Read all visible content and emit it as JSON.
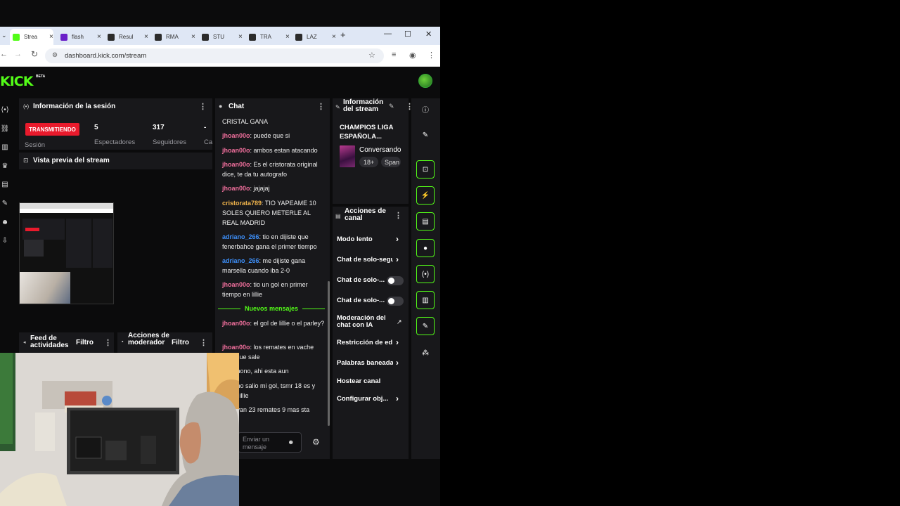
{
  "browser": {
    "tabs": [
      {
        "title": "Strea",
        "active": true,
        "favicon_color": "#53fc18"
      },
      {
        "title": "flash",
        "active": false,
        "favicon_color": "#6a1fc8"
      },
      {
        "title": "Resul",
        "active": false,
        "favicon_color": "#2b2b2b"
      },
      {
        "title": "RMA",
        "active": false,
        "favicon_color": "#2b2b2b"
      },
      {
        "title": "STU",
        "active": false,
        "favicon_color": "#2b2b2b"
      },
      {
        "title": "TRA",
        "active": false,
        "favicon_color": "#2b2b2b"
      },
      {
        "title": "LAZ",
        "active": false,
        "favicon_color": "#2b2b2b"
      }
    ],
    "new_tab": "+",
    "url": "dashboard.kick.com/stream"
  },
  "brand": {
    "logo": "KICK",
    "beta": "BETA",
    "accent": "#53fc18"
  },
  "session": {
    "title": "Información de la sesión",
    "status": "TRANSMITIENDO",
    "session_label": "Sesión",
    "viewers_value": "5",
    "viewers_label": "Espectadores",
    "followers_value": "317",
    "followers_label": "Seguidores",
    "extra_value": "-",
    "extra_label": "Ca"
  },
  "preview": {
    "title": "Vista previa del stream"
  },
  "activity": {
    "title": "Feed de actividades",
    "filter": "Filtro"
  },
  "mod_actions": {
    "title": "Acciones de moderador",
    "filter": "Filtro"
  },
  "chat": {
    "title": "Chat",
    "messages": [
      {
        "user": "",
        "text": "CRISTAL GANA",
        "color": "pink"
      },
      {
        "user": "jhoan00o",
        "text": "puede que si",
        "color": "pink"
      },
      {
        "user": "jhoan00o",
        "text": "ambos estan atacando",
        "color": "pink"
      },
      {
        "user": "jhoan00o",
        "text": "Es el cristorata original dice, te da tu autografo",
        "color": "pink"
      },
      {
        "user": "jhoan00o",
        "text": "jajajaj",
        "color": "pink"
      },
      {
        "user": "cristorata789",
        "text": "TIO YAPEAME 10 SOLES QUIERO METERLE AL REAL MADRID",
        "color": "yellow"
      },
      {
        "user": "adriano_266",
        "text": "tio en dijiste que fenerbahce gana el primer tiempo",
        "color": "blue"
      },
      {
        "user": "adriano_266",
        "text": "me dijiste gana marsella cuando iba 2-0",
        "color": "blue"
      },
      {
        "user": "jhoan00o",
        "text": "tio un gol en primer tiempo en lillie",
        "color": "pink"
      },
      {
        "user": "jhoan00o",
        "text": "el gol de lillie o el parley?",
        "color": "pink"
      },
      {
        "user": "jhoan00o",
        "text": "los remates en vache esta que sale",
        "color": "pink"
      },
      {
        "user": "00o",
        "text": "nono, ahi esta aun",
        "color": "pink"
      },
      {
        "user": "00o",
        "text": "no salio mi gol, tsmr 18 es y nada lillie",
        "color": "pink"
      },
      {
        "user": "00o",
        "text": "van 23 remates 9 mas sta",
        "color": "pink"
      }
    ],
    "new_messages": "Nuevos mensajes",
    "input_placeholder": "Enviar un mensaje"
  },
  "stream_info": {
    "title": "Información del stream",
    "stream_title": "CHAMPIOS LIGA ESPAÑOLA...",
    "category": "Conversando",
    "tag_age": "18+",
    "tag_lang": "Span"
  },
  "channel_actions": {
    "title": "Acciones de canal",
    "items": [
      {
        "label": "Modo lento",
        "type": "chevron"
      },
      {
        "label": "Chat de solo-segu",
        "type": "chevron"
      },
      {
        "label": "Chat de solo-...",
        "type": "toggle"
      },
      {
        "label": "Chat de solo-...",
        "type": "toggle"
      },
      {
        "label": "Moderación del chat con IA",
        "type": "external"
      },
      {
        "label": "Restricción de ed",
        "type": "chevron"
      },
      {
        "label": "Palabras baneada",
        "type": "chevron"
      },
      {
        "label": "Hostear canal",
        "type": "none"
      },
      {
        "label": "Configurar obj...",
        "type": "chevron"
      }
    ]
  }
}
